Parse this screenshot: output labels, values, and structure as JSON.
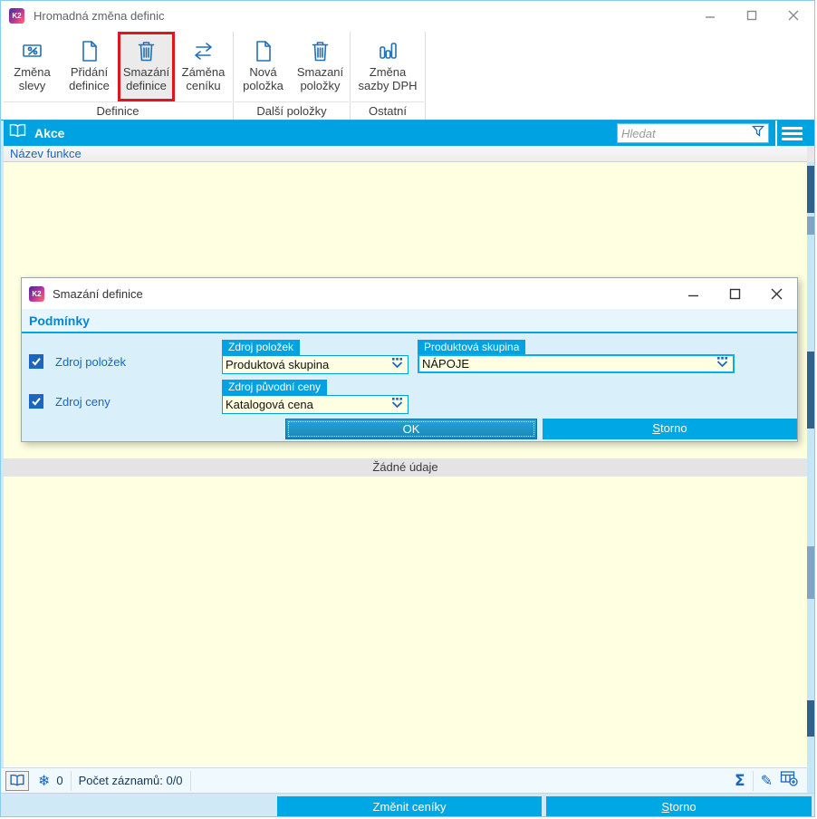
{
  "window": {
    "title": "Hromadná změna definic",
    "k2_badge": "K2"
  },
  "toolbar": {
    "groups": [
      {
        "label": "Definice",
        "buttons": [
          {
            "line1": "Změna",
            "line2": "slevy",
            "icon": "discount-icon"
          },
          {
            "line1": "Přidání",
            "line2": "definice",
            "icon": "document-icon"
          },
          {
            "line1": "Smazání",
            "line2": "definice",
            "icon": "trash-icon",
            "highlighted": true
          },
          {
            "line1": "Záměna",
            "line2": "ceníku",
            "icon": "swap-icon"
          }
        ]
      },
      {
        "label": "Další položky",
        "buttons": [
          {
            "line1": "Nová",
            "line2": "položka",
            "icon": "document-icon"
          },
          {
            "line1": "Smazaní",
            "line2": "položky",
            "icon": "trash-icon"
          }
        ]
      },
      {
        "label": "Ostatní",
        "buttons": [
          {
            "line1": "Změna",
            "line2": "sazby DPH",
            "icon": "bar-chart-icon"
          }
        ]
      }
    ]
  },
  "panel": {
    "title": "Akce",
    "search_placeholder": "Hledat",
    "column_header": "Název funkce",
    "empty_text": "Žádné údaje"
  },
  "dialog": {
    "title": "Smazání definice",
    "section": "Podmínky",
    "rows": [
      {
        "checkbox_label": "Zdroj položek",
        "checked": true
      },
      {
        "checkbox_label": "Zdroj ceny",
        "checked": true
      }
    ],
    "fields": [
      {
        "tag": "Zdroj položek",
        "value": "Produktová skupina"
      },
      {
        "tag": "Produktová skupina",
        "value": "NÁPOJE",
        "focused": true
      },
      {
        "tag": "Zdroj původní ceny",
        "value": "Katalogová cena"
      }
    ],
    "ok_label": "OK",
    "cancel_label": "Storno"
  },
  "status_bar": {
    "frozen_icon": "❄",
    "frozen_count": "0",
    "records_label": "Počet záznamů: 0/0",
    "sum_icon": "Σ",
    "edit_icon": "✎"
  },
  "footer": {
    "apply_label": "Změnit ceníky",
    "cancel_label": "Storno"
  },
  "colors": {
    "accent": "#00a2e2",
    "button": "#00a7e5",
    "ok_button": "#1e93c4",
    "highlight_red": "#e0161f",
    "content_bg": "#ffffe1",
    "dialog_bg": "#d9effa",
    "icon_blue": "#2270b8",
    "text_blue": "#1a66c0"
  }
}
